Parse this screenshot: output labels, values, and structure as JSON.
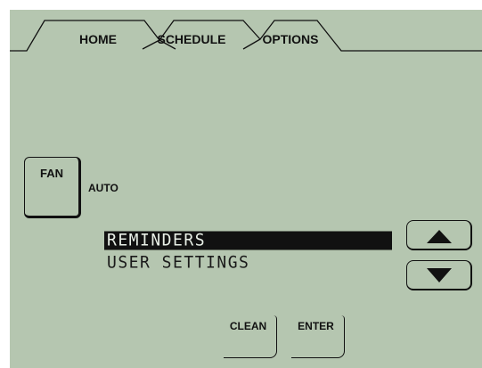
{
  "tabs": [
    {
      "label": "HOME"
    },
    {
      "label": "SCHEDULE"
    },
    {
      "label": "OPTIONS",
      "active": true
    }
  ],
  "fan": {
    "label": "FAN",
    "value": "AUTO"
  },
  "menu": {
    "items": [
      {
        "label": "REMINDERS",
        "selected": true
      },
      {
        "label": "USER SETTINGS",
        "selected": false
      }
    ]
  },
  "buttons": {
    "clean": "CLEAN",
    "enter": "ENTER"
  },
  "icons": {
    "scroll_up": "triangle-up",
    "scroll_down": "triangle-down"
  },
  "colors": {
    "screen_bg": "#b5c6b0",
    "ink": "#111111",
    "selection_text": "#e8efe6"
  }
}
